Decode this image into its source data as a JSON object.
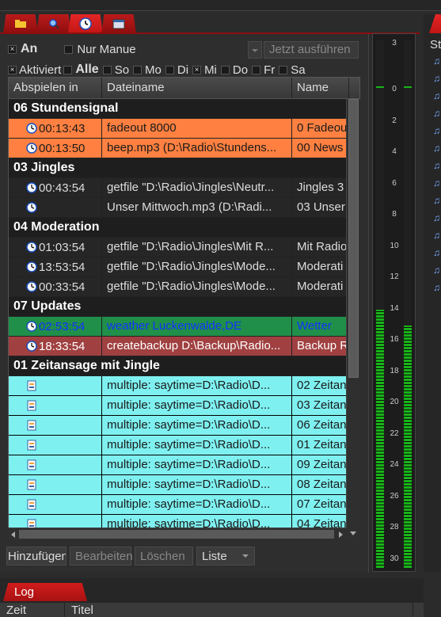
{
  "tabs": {
    "icons": [
      "folder-icon",
      "search-icon",
      "clock-icon",
      "calendar-icon"
    ],
    "active": 2
  },
  "controls": {
    "an_label": "An",
    "nur_manuell_label": "Nur Manue",
    "run_now_label": "Jetzt ausführen",
    "aktiviert_label": "Aktiviert",
    "alle_label": "Alle",
    "days": [
      {
        "label": "So",
        "checked": false
      },
      {
        "label": "Mo",
        "checked": false
      },
      {
        "label": "Di",
        "checked": false
      },
      {
        "label": "Mi",
        "checked": true
      },
      {
        "label": "Do",
        "checked": false
      },
      {
        "label": "Fr",
        "checked": false
      },
      {
        "label": "Sa",
        "checked": false
      }
    ]
  },
  "grid": {
    "columns": [
      "Abspielen in",
      "Dateiname",
      "Name"
    ],
    "groups": [
      {
        "title": "06 Stundensignal",
        "rows": [
          {
            "time": "00:13:43",
            "file": "fadeout 8000",
            "name": "0 Fadeou",
            "style": "orange"
          },
          {
            "time": "00:13:50",
            "file": "beep.mp3 (D:\\Radio\\Stundens...",
            "name": "00 News",
            "style": "orange"
          }
        ]
      },
      {
        "title": "03 Jingles",
        "rows": [
          {
            "time": "00:43:54",
            "file": "getfile \"D:\\Radio\\Jingles\\Neutr...",
            "name": "Jingles 3",
            "style": "dark"
          },
          {
            "time": "",
            "file": "Unser Mittwoch.mp3 (D:\\Radi...",
            "name": "03 Unser",
            "style": "dark"
          }
        ]
      },
      {
        "title": "04 Moderation",
        "rows": [
          {
            "time": "01:03:54",
            "file": "getfile \"D:\\Radio\\Jingles\\Mit R...",
            "name": "Mit Radio",
            "style": "dark"
          },
          {
            "time": "13:53:54",
            "file": "getfile \"D:\\Radio\\Jingles\\Mode...",
            "name": "Moderati",
            "style": "dark"
          },
          {
            "time": "00:33:54",
            "file": "getfile \"D:\\Radio\\Jingles\\Mode...",
            "name": "Moderati",
            "style": "dark"
          }
        ]
      },
      {
        "title": "07 Updates",
        "rows": [
          {
            "time": "02:53:54",
            "file": "weather Luckenwalde,DE",
            "name": "Wetter",
            "style": "green"
          },
          {
            "time": "18:33:54",
            "file": "createbackup D:\\Backup\\Radio...",
            "name": "Backup R",
            "style": "brown"
          }
        ]
      },
      {
        "title": "01 Zeitansage mit Jingle",
        "rows": [
          {
            "time": "",
            "file": "multiple: saytime=D:\\Radio\\D...",
            "name": "02 Zeitan",
            "style": "cyan"
          },
          {
            "time": "",
            "file": "multiple: saytime=D:\\Radio\\D...",
            "name": "03 Zeitan",
            "style": "cyan"
          },
          {
            "time": "",
            "file": "multiple: saytime=D:\\Radio\\D...",
            "name": "06 Zeitan",
            "style": "cyan"
          },
          {
            "time": "",
            "file": "multiple: saytime=D:\\Radio\\D...",
            "name": "01 Zeitan",
            "style": "cyan"
          },
          {
            "time": "",
            "file": "multiple: saytime=D:\\Radio\\D...",
            "name": "09 Zeitan",
            "style": "cyan"
          },
          {
            "time": "",
            "file": "multiple: saytime=D:\\Radio\\D...",
            "name": "08 Zeitan",
            "style": "cyan"
          },
          {
            "time": "",
            "file": "multiple: saytime=D:\\Radio\\D...",
            "name": "07 Zeitan",
            "style": "cyan"
          },
          {
            "time": "",
            "file": "multiple: saytime=D:\\Radio\\D...",
            "name": "04 Zeitan",
            "style": "cyan"
          }
        ]
      }
    ]
  },
  "buttons": {
    "add": "Hinzufügen",
    "edit": "Bearbeiten",
    "delete": "Löschen",
    "list": "Liste"
  },
  "meter": {
    "ticks": [
      "3",
      "0",
      "2",
      "4",
      "6",
      "8",
      "10",
      "12",
      "14",
      "16",
      "18",
      "20",
      "22",
      "24",
      "26",
      "28",
      "30"
    ],
    "left_level": 0.49,
    "right_level": 0.46
  },
  "right_panel": {
    "header": "St"
  },
  "log": {
    "tab": "Log",
    "columns": [
      "Zeit",
      "Titel"
    ]
  }
}
